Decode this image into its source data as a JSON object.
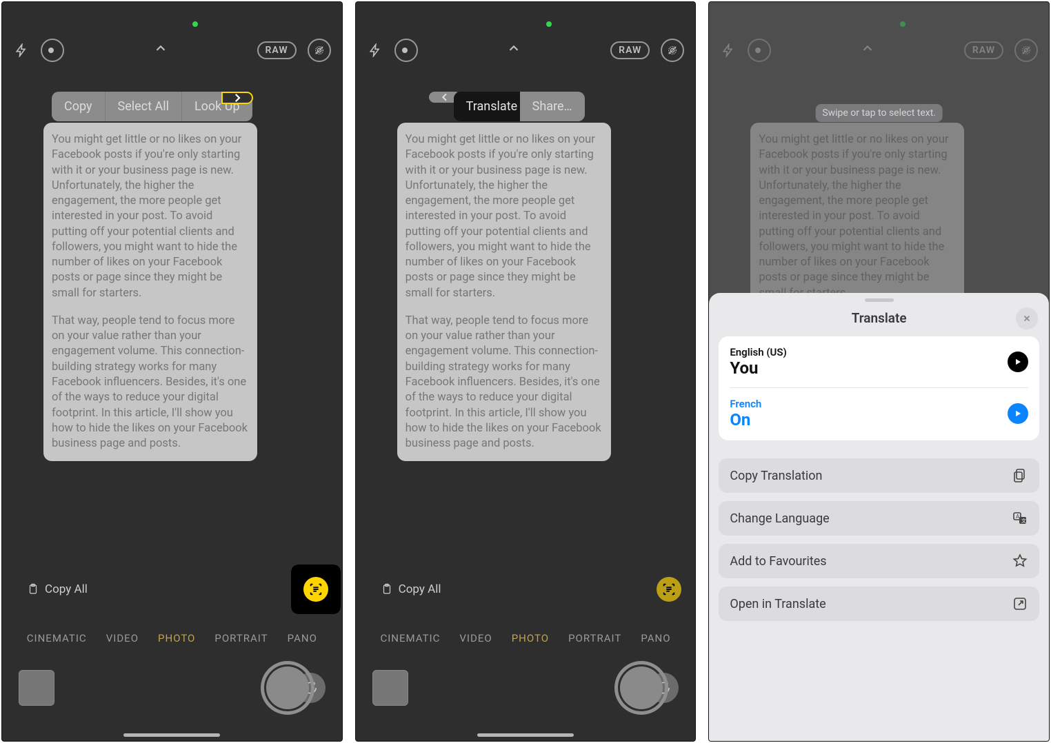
{
  "common": {
    "raw_label": "RAW",
    "copy_all_label": "Copy All",
    "modes": [
      "CINEMATIC",
      "VIDEO",
      "PHOTO",
      "PORTRAIT",
      "PANO"
    ],
    "active_mode_index": 2,
    "viewfinder_text": {
      "p1": "You might get little or no likes on your Facebook posts if you're only starting with it or your business page is new. Unfortunately, the higher the engagement, the more people get interested in your post. To avoid putting off your potential clients and followers, you might want to hide the number of likes on your Facebook posts or page since they might be small for starters.",
      "p2": "That way, people tend to focus more on your value rather than your engagement volume. This connection-building strategy works for many Facebook influencers. Besides, it's one of the ways to reduce your digital footprint. In this article, I'll show you how to hide the likes on your Facebook business page and posts."
    }
  },
  "screen1": {
    "context_menu": [
      "Copy",
      "Select All",
      "Look Up"
    ]
  },
  "screen2": {
    "context_menu": [
      "Translate",
      "Share…"
    ]
  },
  "screen3": {
    "hint": "Swipe or tap to select text.",
    "sheet": {
      "title": "Translate",
      "source": {
        "lang": "English (US)",
        "text": "You"
      },
      "target": {
        "lang": "French",
        "text": "On"
      },
      "actions": [
        {
          "label": "Copy Translation",
          "icon": "copy"
        },
        {
          "label": "Change Language",
          "icon": "lang"
        },
        {
          "label": "Add to Favourites",
          "icon": "star"
        },
        {
          "label": "Open in Translate",
          "icon": "open"
        }
      ]
    }
  }
}
